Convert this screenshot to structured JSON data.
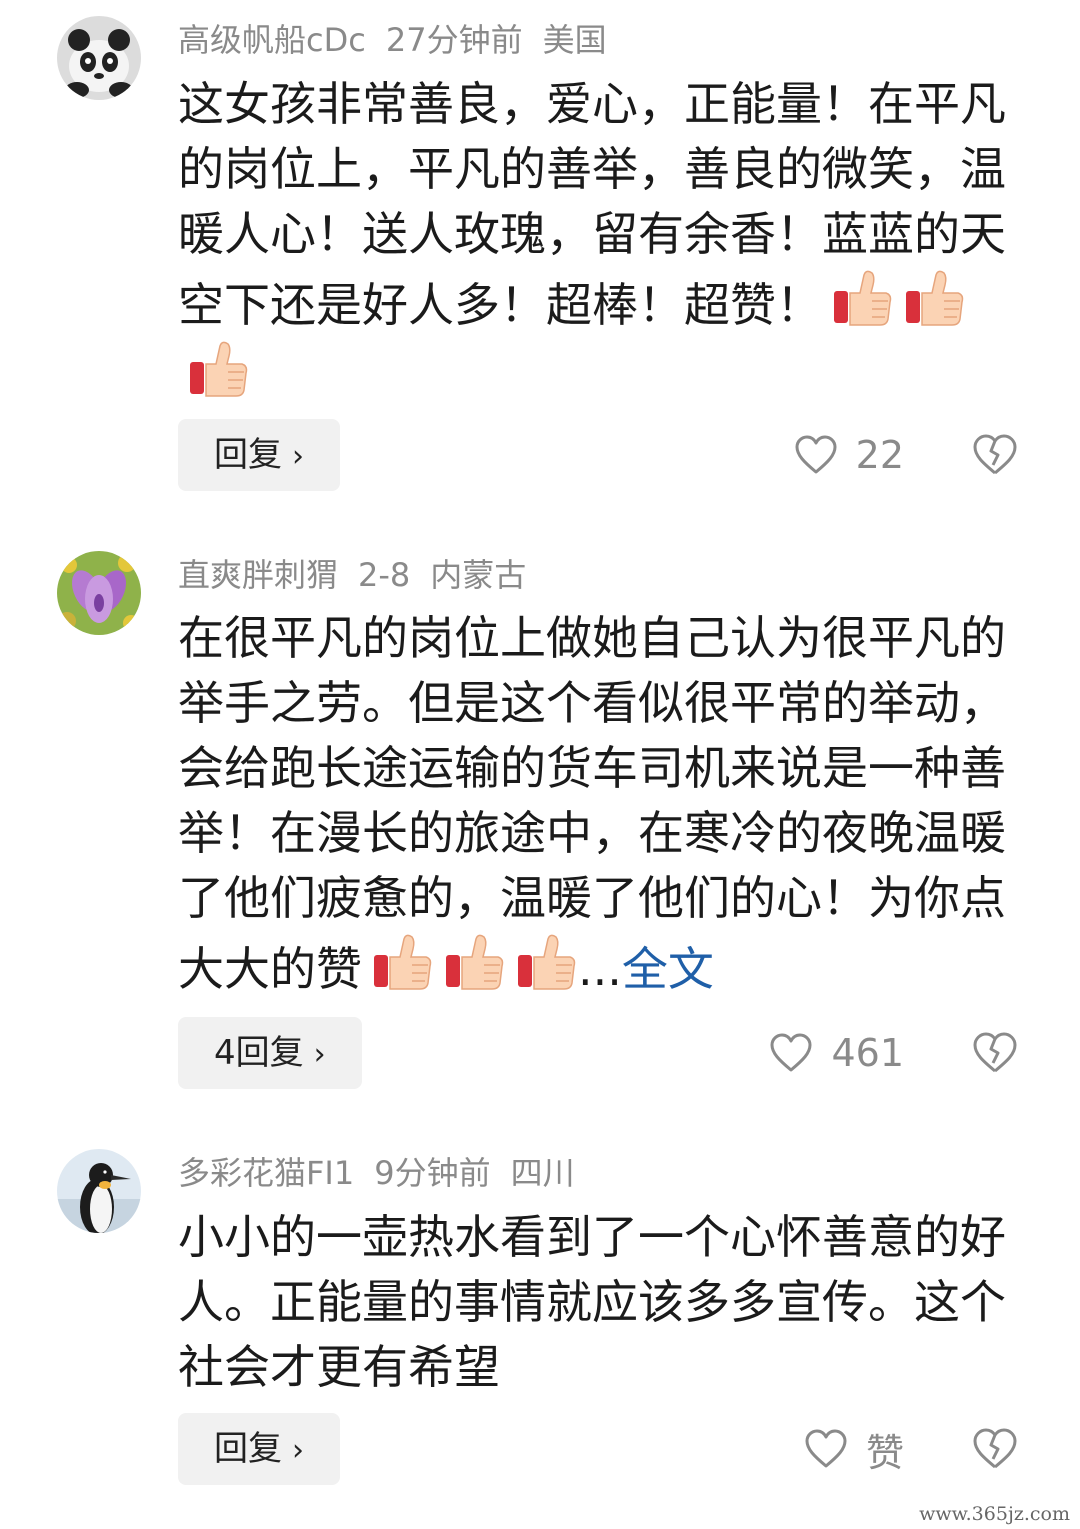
{
  "comments": [
    {
      "user": "高级帆船cDc",
      "time": "27分钟前",
      "location": "美国",
      "avatar_icon": "panda-avatar",
      "text": "这女孩非常善良，爱心，正能量！在平凡的岗位上，平凡的善举，善良的微笑，温暖人心！送人玫瑰，留有余香！蓝蓝的天空下还是好人多！超棒！超赞！",
      "emoji": [
        "thumbs-up",
        "thumbs-up",
        "thumbs-up"
      ],
      "reply_label": "回复",
      "like_count": "22"
    },
    {
      "user": "直爽胖刺猬",
      "time": "2-8",
      "location": "内蒙古",
      "avatar_icon": "purple-flower-avatar",
      "text": "在很平凡的岗位上做她自己认为很平凡的举手之劳。但是这个看似很平常的举动，会给跑长途运输的货车司机来说是一种善举！在漫长的旅途中，在寒冷的夜晚温暖了他们疲惫的，温暖了他们的心！为你点大大的赞",
      "emoji": [
        "thumbs-up",
        "thumbs-up",
        "thumbs-up"
      ],
      "ellipsis": "...",
      "more_label": "全文",
      "reply_label": "4回复",
      "like_count": "461"
    },
    {
      "user": "多彩花猫FI1",
      "time": "9分钟前",
      "location": "四川",
      "avatar_icon": "penguin-avatar",
      "text": "小小的一壶热水看到了一个心怀善意的好人。正能量的事情就应该多多宣传。这个社会才更有希望",
      "reply_label": "回复",
      "like_count": "赞"
    }
  ],
  "watermark": "www.365jz.com",
  "colors": {
    "meta": "#8a8a8a",
    "link": "#1f5fa8",
    "reply_bg": "#f1f1f1"
  }
}
